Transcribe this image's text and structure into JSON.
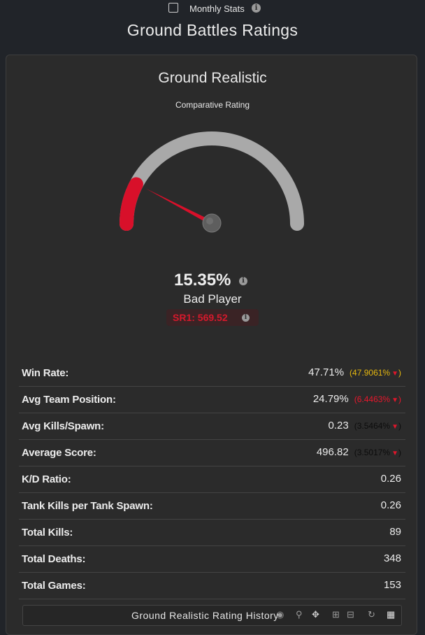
{
  "header": {
    "monthly_stats_label": "Monthly Stats",
    "title": "Ground Battles Ratings"
  },
  "mode": {
    "title": "Ground Realistic",
    "comparative_label": "Comparative Rating",
    "gauge": {
      "fraction": 0.1535,
      "min_color": "#d8102a",
      "track_color": "#a9a9a9",
      "needle_color": "#d8102a"
    },
    "rating_value": "15.35%",
    "rating_label": "Bad Player",
    "sr_text": "SR1: 569.52"
  },
  "stats": [
    {
      "label": "Win Rate:",
      "value": "47.71%",
      "delta": "(47.9061%",
      "delta_color": "yellow",
      "arrow": true
    },
    {
      "label": "Avg Team Position:",
      "value": "24.79%",
      "delta": "(6.4463%",
      "delta_color": "red",
      "arrow": true
    },
    {
      "label": "Avg Kills/Spawn:",
      "value": "0.23",
      "delta": "(3.5464%",
      "delta_color": "dark",
      "arrow": true
    },
    {
      "label": "Average Score:",
      "value": "496.82",
      "delta": "(3.5017%",
      "delta_color": "dark",
      "arrow": true
    },
    {
      "label": "K/D Ratio:",
      "value": "0.26",
      "delta": "",
      "delta_color": "",
      "arrow": false
    },
    {
      "label": "Tank Kills per Tank Spawn:",
      "value": "0.26",
      "delta": "",
      "delta_color": "",
      "arrow": false
    },
    {
      "label": "Total Kills:",
      "value": "89",
      "delta": "",
      "delta_color": "",
      "arrow": false
    },
    {
      "label": "Total Deaths:",
      "value": "348",
      "delta": "",
      "delta_color": "",
      "arrow": false
    },
    {
      "label": "Total Games:",
      "value": "153",
      "delta": "",
      "delta_color": "",
      "arrow": false
    }
  ],
  "history": {
    "title": "Ground Realistic Rating History",
    "tools": [
      "camera-icon",
      "zoom-icon",
      "pan-icon",
      "zoom-in-icon",
      "zoom-out-icon",
      "reset-icon",
      "chart-menu-icon"
    ]
  }
}
